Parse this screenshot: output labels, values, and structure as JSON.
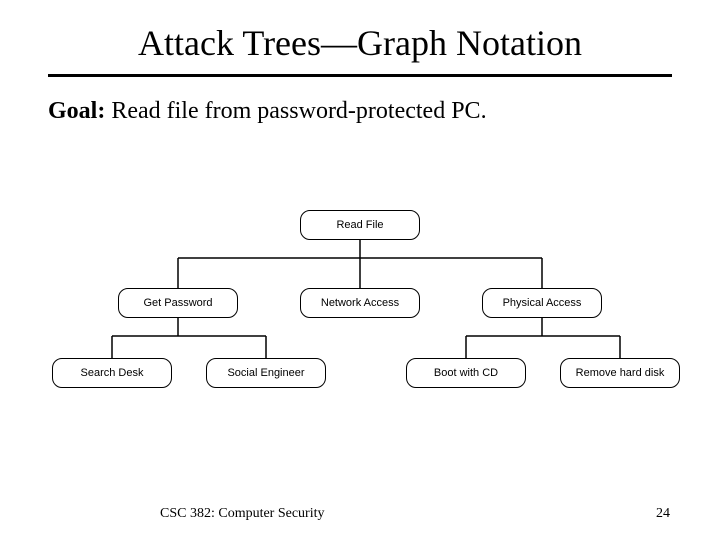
{
  "title": "Attack Trees—Graph Notation",
  "goal_label": "Goal:",
  "goal_text": " Read file from password-protected PC.",
  "tree": {
    "root": "Read File",
    "level2": {
      "get_password": "Get Password",
      "network_access": "Network Access",
      "physical_access": "Physical Access"
    },
    "level3": {
      "search_desk": "Search Desk",
      "social_engineer": "Social Engineer",
      "boot_with_cd": "Boot with CD",
      "remove_hard_disk": "Remove hard disk"
    }
  },
  "footer": {
    "course": "CSC 382: Computer Security",
    "page_number": "24"
  }
}
